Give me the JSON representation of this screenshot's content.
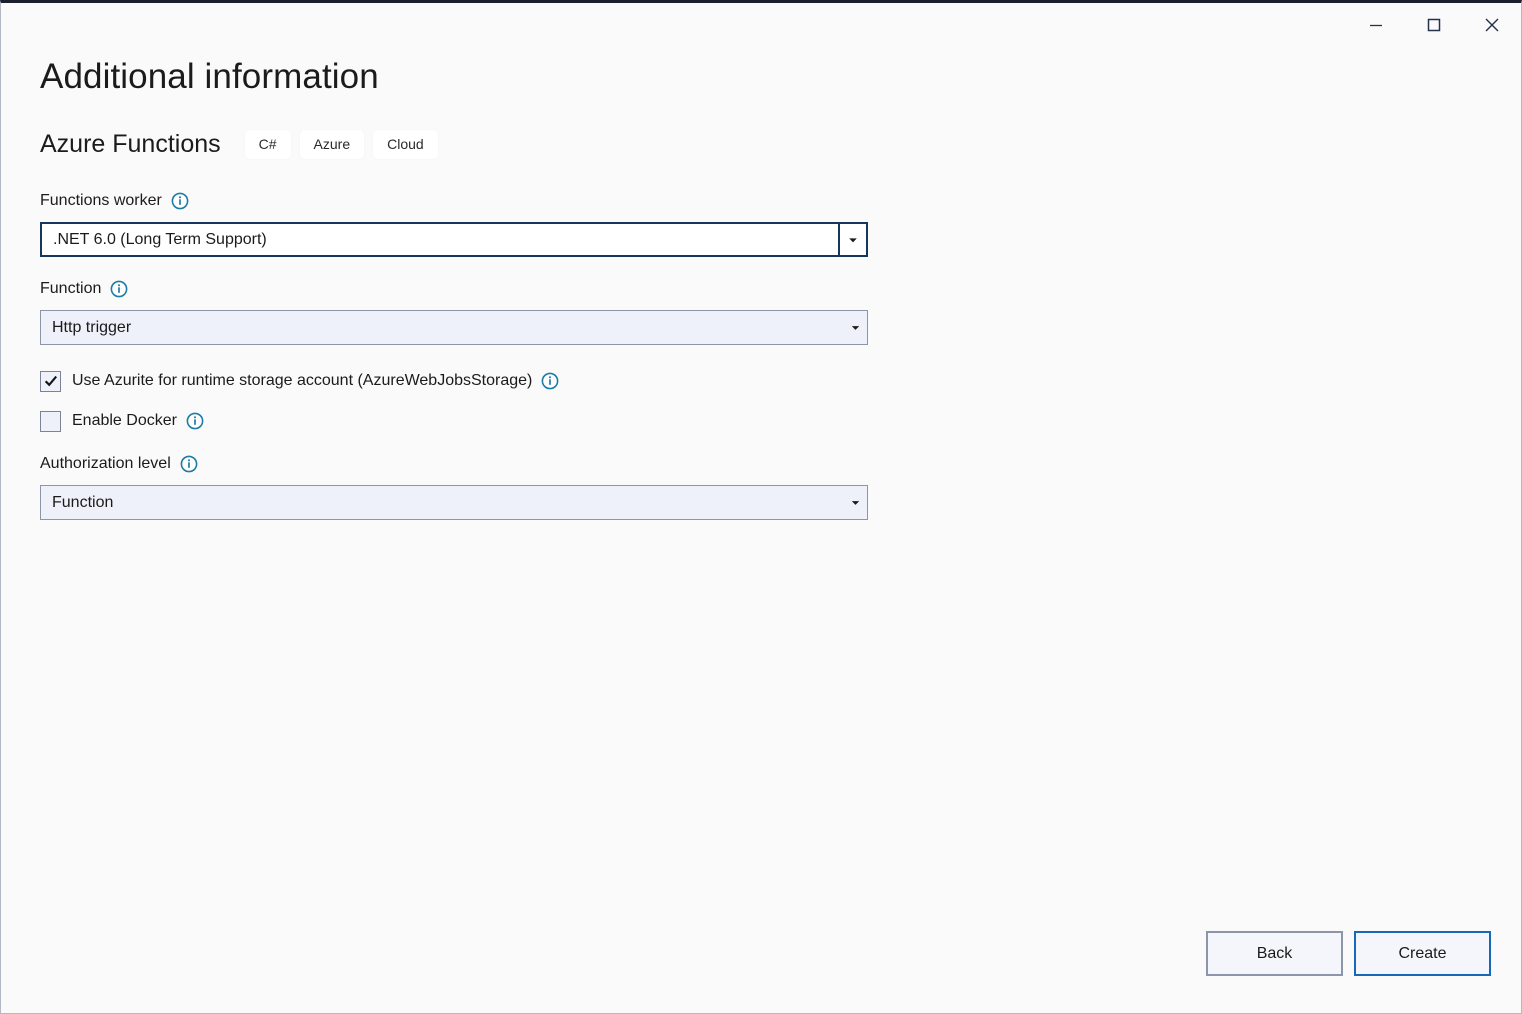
{
  "window": {
    "controls": [
      {
        "name": "minimize",
        "label": "Minimize"
      },
      {
        "name": "maximize",
        "label": "Maximize"
      },
      {
        "name": "close",
        "label": "Close"
      }
    ]
  },
  "header": {
    "title": "Additional information",
    "subtitle": "Azure Functions",
    "tags": [
      "C#",
      "Azure",
      "Cloud"
    ]
  },
  "form": {
    "functions_worker": {
      "label": "Functions worker",
      "value": ".NET 6.0 (Long Term Support)",
      "info": "info-icon"
    },
    "function": {
      "label": "Function",
      "value": "Http trigger",
      "info": "info-icon"
    },
    "use_azurite": {
      "label": "Use Azurite for runtime storage account (AzureWebJobsStorage)",
      "checked": true,
      "info": "info-icon"
    },
    "enable_docker": {
      "label": "Enable Docker",
      "checked": false,
      "info": "info-icon"
    },
    "authorization_level": {
      "label": "Authorization level",
      "value": "Function",
      "info": "info-icon"
    }
  },
  "footer": {
    "back_label": "Back",
    "create_label": "Create"
  },
  "colors": {
    "page_background": "#fafafa",
    "focus_border": "#17365d",
    "field_fill": "#eff1fa",
    "field_border": "#8d95a8",
    "primary_border": "#1668b8",
    "info_icon": "#1e7ba6",
    "text": "#1b1b1b"
  }
}
